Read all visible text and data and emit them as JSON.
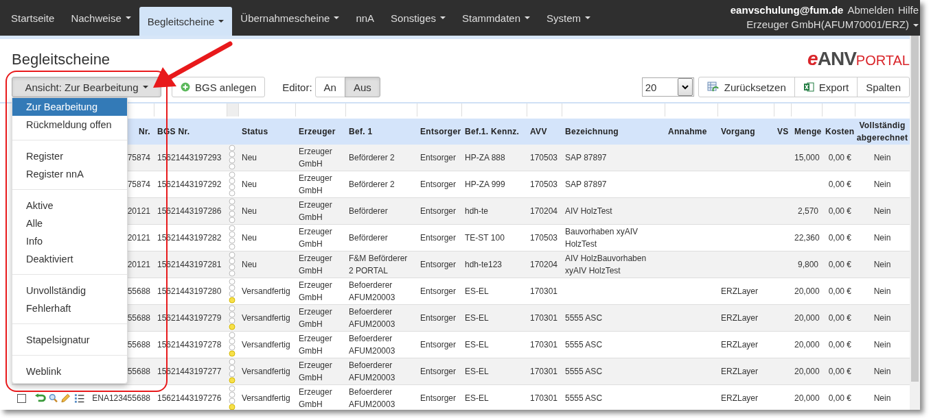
{
  "nav": {
    "items": [
      {
        "label": "Startseite",
        "selected": false,
        "dropdown": false
      },
      {
        "label": "Nachweise",
        "selected": false,
        "dropdown": true
      },
      {
        "label": "Begleitscheine",
        "selected": true,
        "dropdown": true
      },
      {
        "label": "Übernahmescheine",
        "selected": false,
        "dropdown": true
      },
      {
        "label": "nnA",
        "selected": false,
        "dropdown": false
      },
      {
        "label": "Sonstiges",
        "selected": false,
        "dropdown": true
      },
      {
        "label": "Stammdaten",
        "selected": false,
        "dropdown": true
      },
      {
        "label": "System",
        "selected": false,
        "dropdown": true
      }
    ],
    "user": "eanvschulung@fum.de",
    "logout": "Abmelden",
    "help": "Hilfe",
    "account": "Erzeuger GmbH(AFUM70001/ERZ)"
  },
  "page_title": "Begleitscheine",
  "logo": [
    {
      "text": "e",
      "kind": "accent"
    },
    {
      "text": "ANV",
      "kind": "main"
    },
    {
      "text": "PORTAL",
      "kind": "small"
    }
  ],
  "toolbar": {
    "view_button": "Ansicht: Zur Bearbeitung",
    "create_button": "BGS anlegen",
    "editor_label": "Editor:",
    "editor_options": [
      {
        "label": "An",
        "selected": false
      },
      {
        "label": "Aus",
        "selected": true
      }
    ],
    "page_size": "20",
    "reset_button": "Zurücksetzen",
    "export_button": "Export",
    "columns_button": "Spalten"
  },
  "view_menu": {
    "groups": [
      [
        {
          "label": "Zur Bearbeitung",
          "selected": true
        },
        {
          "label": "Rückmeldung offen",
          "selected": false
        }
      ],
      [
        {
          "label": "Register",
          "selected": false
        },
        {
          "label": "Register nnA",
          "selected": false
        }
      ],
      [
        {
          "label": "Aktive",
          "selected": false
        },
        {
          "label": "Alle",
          "selected": false
        },
        {
          "label": "Info",
          "selected": false
        },
        {
          "label": "Deaktiviert",
          "selected": false
        }
      ],
      [
        {
          "label": "Unvollständig",
          "selected": false
        },
        {
          "label": "Fehlerhaft",
          "selected": false
        }
      ],
      [
        {
          "label": "Stapelsignatur",
          "selected": false
        }
      ],
      [
        {
          "label": "Weblink",
          "selected": false
        }
      ]
    ]
  },
  "table": {
    "columns": {
      "nr": "Nr.",
      "bgs": "BGS Nr.",
      "status": "Status",
      "erzeuger": "Erzeuger",
      "bef1": "Bef. 1",
      "entsorger": "Entsorger",
      "kennz": "Bef.1. Kennz.",
      "avv": "AVV",
      "bez": "Bezeichnung",
      "annahme": "Annahme",
      "vorgang": "Vorgang",
      "vs": "VS",
      "menge": "Menge",
      "kosten": "Kosten",
      "voll": "Vollständig abgerechnet"
    },
    "rows": [
      {
        "tools": false,
        "nr": "75874",
        "bgs": "15621443197293",
        "status": "Neu",
        "erzeuger": "Erzeuger GmbH",
        "bef1": "Beförderer 2",
        "entsorger": "Entsorger",
        "kennz": "HP-ZA 888",
        "avv": "170503",
        "bez": "SAP 87897",
        "menge": "15,000",
        "kosten": "0,00 €",
        "voll": "Nein"
      },
      {
        "tools": false,
        "nr": "75874",
        "bgs": "15621443197292",
        "status": "Neu",
        "erzeuger": "Erzeuger GmbH",
        "bef1": "Beförderer 2",
        "entsorger": "Entsorger",
        "kennz": "HP-ZA 999",
        "avv": "170503",
        "bez": "SAP 87897",
        "kosten": "0,00 €",
        "voll": "Nein"
      },
      {
        "tools": false,
        "nr": "20121",
        "bgs": "15621443197286",
        "status": "Neu",
        "erzeuger": "Erzeuger GmbH",
        "bef1": "Beförderer",
        "entsorger": "Entsorger",
        "kennz": "hdh-te",
        "avv": "170204",
        "bez": "AIV HolzTest",
        "menge": "2,570",
        "kosten": "0,00 €",
        "voll": "Nein"
      },
      {
        "tools": false,
        "nr": "20121",
        "bgs": "15621443197282",
        "status": "Neu",
        "erzeuger": "Erzeuger GmbH",
        "bef1": "Beförderer",
        "entsorger": "Entsorger",
        "kennz": "TE-ST 100",
        "avv": "170503",
        "bez": "Bauvorhaben xyAIV HolzTest",
        "menge": "22,360",
        "kosten": "0,00 €",
        "voll": "Nein"
      },
      {
        "tools": false,
        "nr": "20121",
        "bgs": "15621443197281",
        "status": "Neu",
        "erzeuger": "Erzeuger GmbH",
        "bef1": "F&M Beförderer 2 PORTAL",
        "entsorger": "Entsorger",
        "kennz": "hdh-te123",
        "avv": "170204",
        "bez": "AIV HolzBauvorhaben xyAIV HolzTest",
        "menge": "9,800",
        "kosten": "0,00 €",
        "voll": "Nein"
      },
      {
        "tools": false,
        "color": "#f7e04a",
        "nr": "55688",
        "bgs": "15621443197280",
        "status": "Versandfertig",
        "erzeuger": "Erzeuger GmbH",
        "bef1": "Befoerderer AFUM20003",
        "entsorger": "Entsorger",
        "kennz": "ES-EL",
        "avv": "170301",
        "vorgang": "ERZLayer",
        "menge": "20,000",
        "kosten": "0,00 €",
        "voll": "Nein"
      },
      {
        "tools": false,
        "color": "#f7e04a",
        "nr": "55688",
        "bgs": "15621443197279",
        "status": "Versandfertig",
        "erzeuger": "Erzeuger GmbH",
        "bef1": "Befoerderer AFUM20003",
        "entsorger": "Entsorger",
        "kennz": "ES-EL",
        "avv": "170301",
        "bez": "5555 ASC",
        "vorgang": "ERZLayer",
        "menge": "20,000",
        "kosten": "0,00 €",
        "voll": "Nein"
      },
      {
        "tools": false,
        "color": "#f7e04a",
        "nr": "55688",
        "bgs": "15621443197278",
        "status": "Versandfertig",
        "erzeuger": "Erzeuger GmbH",
        "bef1": "Befoerderer AFUM20003",
        "entsorger": "Entsorger",
        "kennz": "ES-EL",
        "avv": "170301",
        "bez": "5555 ASC",
        "vorgang": "ERZLayer",
        "menge": "20,000",
        "kosten": "0,00 €",
        "voll": "Nein"
      },
      {
        "tools": false,
        "color": "#f7e04a",
        "nr": "55688",
        "bgs": "15621443197277",
        "status": "Versandfertig",
        "erzeuger": "Erzeuger GmbH",
        "bef1": "Befoerderer AFUM20003",
        "entsorger": "Entsorger",
        "kennz": "ES-EL",
        "avv": "170301",
        "bez": "5555 ASC",
        "vorgang": "ERZLayer",
        "menge": "20,000",
        "kosten": "0,00 €",
        "voll": "Nein"
      },
      {
        "tools": true,
        "checked": false,
        "color": "#f7e04a",
        "nr": "ENA123455688",
        "bgs": "15621443197276",
        "status": "Versandfertig",
        "erzeuger": "Erzeuger GmbH",
        "bef1": "Befoerderer AFUM20003",
        "entsorger": "Entsorger",
        "kennz": "ES-EL",
        "avv": "170301",
        "bez": "5555 ASC",
        "vorgang": "ERZLayer",
        "menge": "20,000",
        "kosten": "0,00 €",
        "voll": "Nein"
      }
    ]
  }
}
